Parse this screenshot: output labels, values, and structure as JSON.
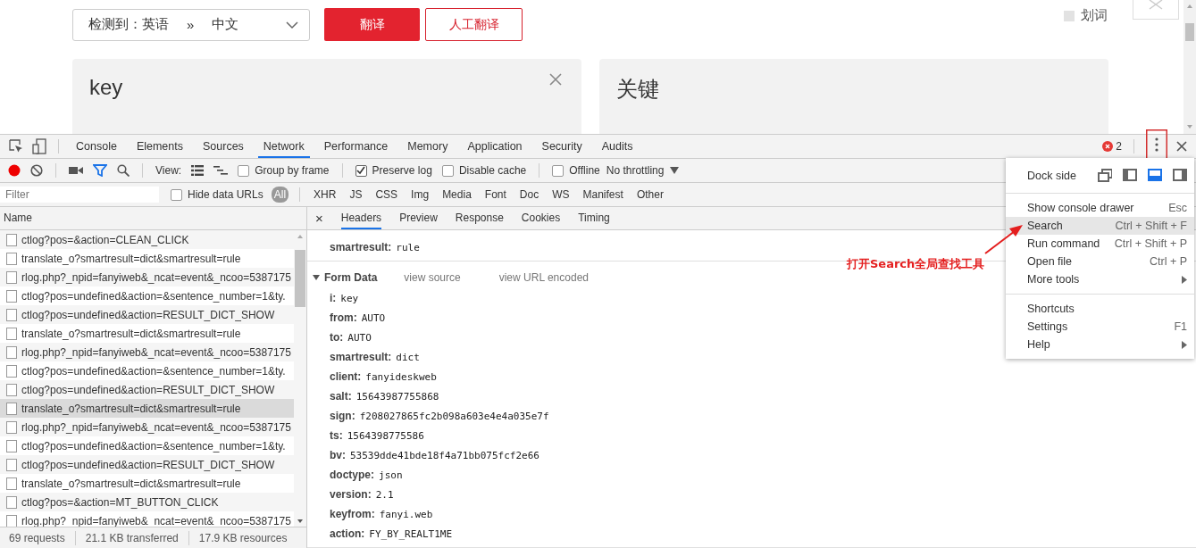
{
  "page": {
    "language_select": {
      "detected": "检测到：英语",
      "separator": "»",
      "target": "中文"
    },
    "translate_button": "翻译",
    "human_button": "人工翻译",
    "word_pick": {
      "label": "划词",
      "checked": false
    },
    "source_text": "key",
    "result_text": "关键"
  },
  "devtools": {
    "tabs": [
      {
        "label": "Console",
        "selected": false
      },
      {
        "label": "Elements",
        "selected": false
      },
      {
        "label": "Sources",
        "selected": false
      },
      {
        "label": "Network",
        "selected": true
      },
      {
        "label": "Performance",
        "selected": false
      },
      {
        "label": "Memory",
        "selected": false
      },
      {
        "label": "Application",
        "selected": false
      },
      {
        "label": "Security",
        "selected": false
      },
      {
        "label": "Audits",
        "selected": false
      }
    ],
    "error_count": "2",
    "toolbar": {
      "recording": true,
      "filter_on": true,
      "view_label": "View:",
      "checkboxes": [
        {
          "label": "Group by frame",
          "checked": false
        },
        {
          "label": "Preserve log",
          "checked": true
        },
        {
          "label": "Disable cache",
          "checked": false
        },
        {
          "label": "Offline",
          "checked": false
        }
      ],
      "throttling": "No throttling"
    },
    "filter": {
      "placeholder": "Filter",
      "hide_data_urls": {
        "label": "Hide data URLs",
        "checked": false
      },
      "types": [
        {
          "label": "All",
          "selected": true
        },
        {
          "label": "XHR",
          "selected": false
        },
        {
          "label": "JS",
          "selected": false
        },
        {
          "label": "CSS",
          "selected": false
        },
        {
          "label": "Img",
          "selected": false
        },
        {
          "label": "Media",
          "selected": false
        },
        {
          "label": "Font",
          "selected": false
        },
        {
          "label": "Doc",
          "selected": false
        },
        {
          "label": "WS",
          "selected": false
        },
        {
          "label": "Manifest",
          "selected": false
        },
        {
          "label": "Other",
          "selected": false
        }
      ]
    },
    "requests": {
      "header": "Name",
      "rows": [
        {
          "name": "ctlog?pos=&action=CLEAN_CLICK",
          "selected": false
        },
        {
          "name": "translate_o?smartresult=dict&smartresult=rule",
          "selected": false
        },
        {
          "name": "rlog.php?_npid=fanyiweb&_ncat=event&_ncoo=5387175",
          "selected": false
        },
        {
          "name": "ctlog?pos=undefined&action=&sentence_number=1&ty.",
          "selected": false
        },
        {
          "name": "ctlog?pos=undefined&action=RESULT_DICT_SHOW",
          "selected": false
        },
        {
          "name": "translate_o?smartresult=dict&smartresult=rule",
          "selected": false
        },
        {
          "name": "rlog.php?_npid=fanyiweb&_ncat=event&_ncoo=5387175",
          "selected": false
        },
        {
          "name": "ctlog?pos=undefined&action=&sentence_number=1&ty.",
          "selected": false
        },
        {
          "name": "ctlog?pos=undefined&action=RESULT_DICT_SHOW",
          "selected": false
        },
        {
          "name": "translate_o?smartresult=dict&smartresult=rule",
          "selected": true
        },
        {
          "name": "rlog.php?_npid=fanyiweb&_ncat=event&_ncoo=5387175",
          "selected": false
        },
        {
          "name": "ctlog?pos=undefined&action=&sentence_number=1&ty.",
          "selected": false
        },
        {
          "name": "ctlog?pos=undefined&action=RESULT_DICT_SHOW",
          "selected": false
        },
        {
          "name": "translate_o?smartresult=dict&smartresult=rule",
          "selected": false
        },
        {
          "name": "ctlog?pos=&action=MT_BUTTON_CLICK",
          "selected": false
        },
        {
          "name": "rlog.php?_npid=fanyiweb&_ncat=event&_ncoo=5387175",
          "selected": false
        }
      ],
      "status": [
        "69 requests",
        "21.1 KB transferred",
        "17.9 KB resources"
      ]
    },
    "detail": {
      "close": "×",
      "tabs": [
        {
          "label": "Headers",
          "selected": true
        },
        {
          "label": "Preview",
          "selected": false
        },
        {
          "label": "Response",
          "selected": false
        },
        {
          "label": "Cookies",
          "selected": false
        },
        {
          "label": "Timing",
          "selected": false
        }
      ],
      "query_params": [
        {
          "key": "smartresult:",
          "value": "rule"
        }
      ],
      "form_data": {
        "title": "Form Data",
        "expanded": true,
        "links": [
          "view source",
          "view URL encoded"
        ],
        "params": [
          {
            "key": "i:",
            "value": "key"
          },
          {
            "key": "from:",
            "value": "AUTO"
          },
          {
            "key": "to:",
            "value": "AUTO"
          },
          {
            "key": "smartresult:",
            "value": "dict"
          },
          {
            "key": "client:",
            "value": "fanyideskweb"
          },
          {
            "key": "salt:",
            "value": "15643987755868"
          },
          {
            "key": "sign:",
            "value": "f208027865fc2b098a603e4e4a035e7f"
          },
          {
            "key": "ts:",
            "value": "1564398775586"
          },
          {
            "key": "bv:",
            "value": "53539dde41bde18f4a71bb075fcf2e66"
          },
          {
            "key": "doctype:",
            "value": "json"
          },
          {
            "key": "version:",
            "value": "2.1"
          },
          {
            "key": "keyfrom:",
            "value": "fanyi.web"
          },
          {
            "key": "action:",
            "value": "FY_BY_REALT1ME"
          }
        ]
      }
    },
    "menu": {
      "dock_label": "Dock side",
      "dock_options": [
        {
          "kind": "undock",
          "selected": false
        },
        {
          "kind": "left",
          "selected": false
        },
        {
          "kind": "bottom",
          "selected": true
        },
        {
          "kind": "right",
          "selected": false
        }
      ],
      "groups": [
        [
          {
            "label": "Show console drawer",
            "shortcut": "Esc",
            "submenu": false,
            "highlighted": false
          },
          {
            "label": "Search",
            "shortcut": "Ctrl + Shift + F",
            "submenu": false,
            "highlighted": true
          },
          {
            "label": "Run command",
            "shortcut": "Ctrl + Shift + P",
            "submenu": false,
            "highlighted": false
          },
          {
            "label": "Open file",
            "shortcut": "Ctrl + P",
            "submenu": false,
            "highlighted": false
          },
          {
            "label": "More tools",
            "submenu": true,
            "highlighted": false
          }
        ],
        [
          {
            "label": "Shortcuts",
            "submenu": false,
            "highlighted": false
          },
          {
            "label": "Settings",
            "shortcut": "F1",
            "submenu": false,
            "highlighted": false
          },
          {
            "label": "Help",
            "submenu": true,
            "highlighted": false
          }
        ]
      ]
    },
    "annotation": "打开Search全局查找工具"
  }
}
